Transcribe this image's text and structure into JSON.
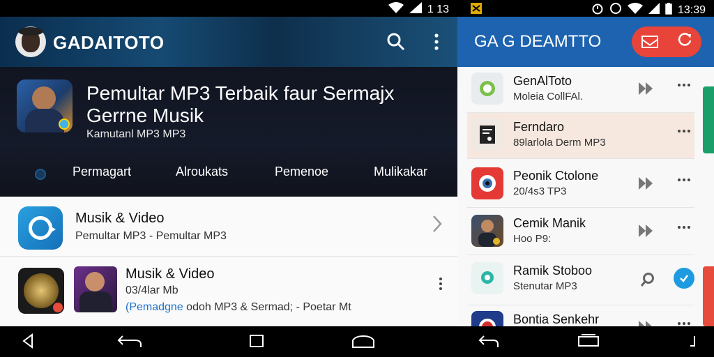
{
  "left": {
    "status": {
      "time": "1 13"
    },
    "appbar": {
      "brand": "GADAITOTO"
    },
    "hero": {
      "title": "Pemultar MP3 Terbaik faur Sermajx Gerrne Musik",
      "subtitle": "Kamutanl MP3 MP3",
      "tabs": [
        "Permagart",
        "Alroukats",
        "Pemenoe",
        "Mulikakar"
      ]
    },
    "list": [
      {
        "title": "Musik & Video",
        "subtitle": "Pemultar MP3 - Pemultar MP3"
      },
      {
        "title": "Musik & Video",
        "subtitle": "03/4lar Mb",
        "desc_link": "(Pemadgne",
        "desc_rest": " odoh MP3 & Sermad; - Poetar Mt"
      }
    ]
  },
  "right": {
    "status": {
      "time": "13:39"
    },
    "appbar": {
      "brand": "GA  G DEAMTTO"
    },
    "list": [
      {
        "title": "GenAlToto",
        "subtitle": "Moleia CollFAl.",
        "icon_color": "#e9ecef"
      },
      {
        "title": "Ferndaro",
        "subtitle": "89larlola Derm MP3",
        "icon_color": "#222222"
      },
      {
        "title": "Peonik Ctolone",
        "subtitle": "20/4s3 TP3",
        "icon_color": "#e53935"
      },
      {
        "title": "Cemik Manik",
        "subtitle": "Hoo P9:",
        "icon_color": "#3b2a1a"
      },
      {
        "title": "Ramik Stoboo",
        "subtitle": "Stenutar MP3",
        "icon_color": "#e9f3f1"
      },
      {
        "title": "Bontia Senkehr",
        "subtitle": "",
        "icon_color": "#1f3c8a"
      }
    ]
  },
  "colors": {
    "appbar_right": "#1d63b0",
    "accent_red": "#e8443a",
    "link": "#1b74c9"
  }
}
